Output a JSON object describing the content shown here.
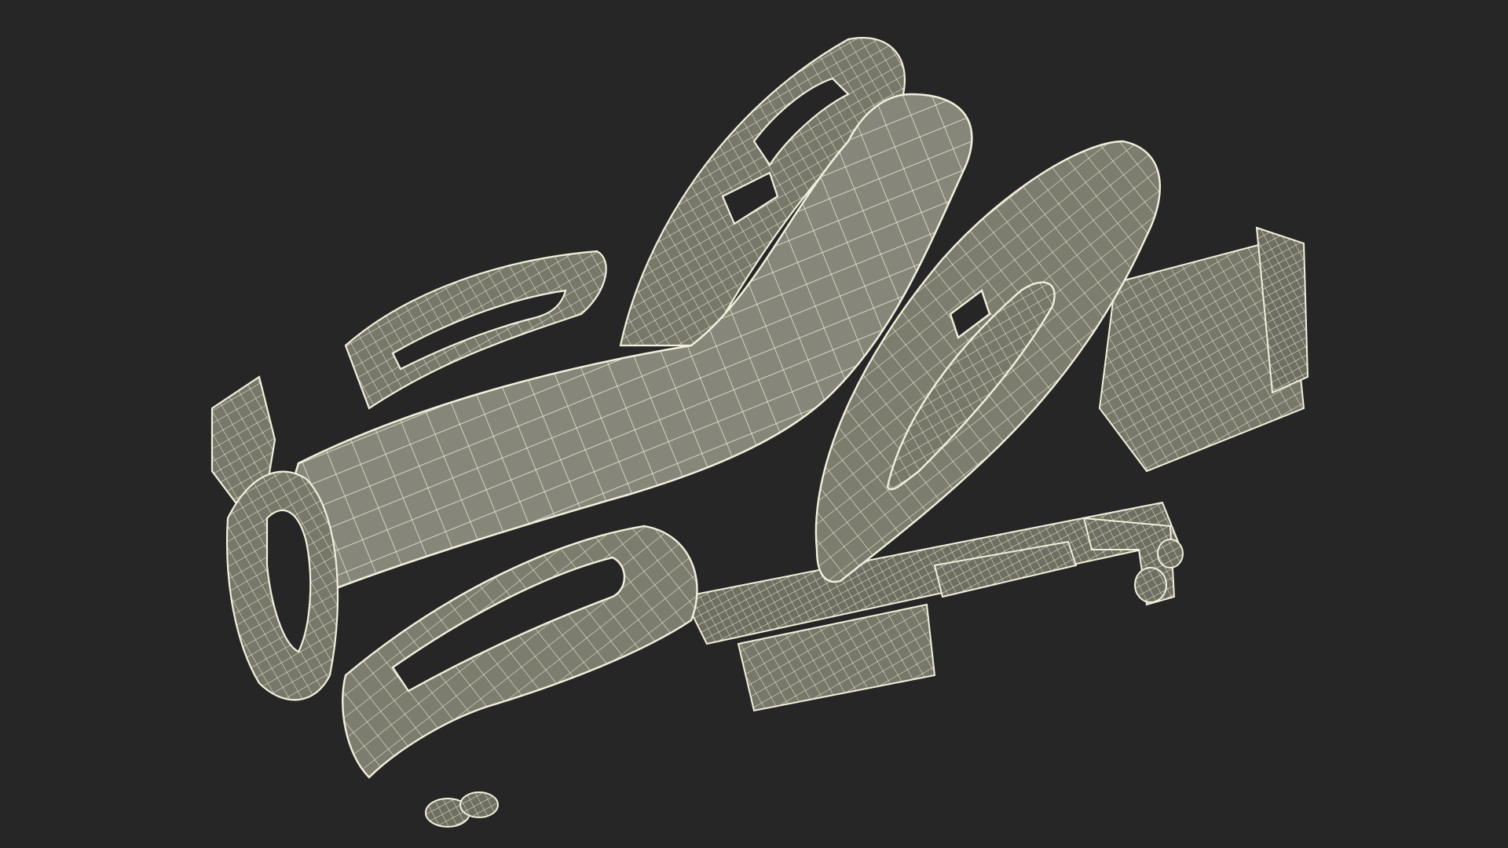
{
  "scene": {
    "background_color": "#262626",
    "mesh_fill": "#8a8a78",
    "mesh_fill_dark": "#6f6f60",
    "wire_color": "#f2f0dc",
    "subject": "hospital-bed-wireframe"
  }
}
